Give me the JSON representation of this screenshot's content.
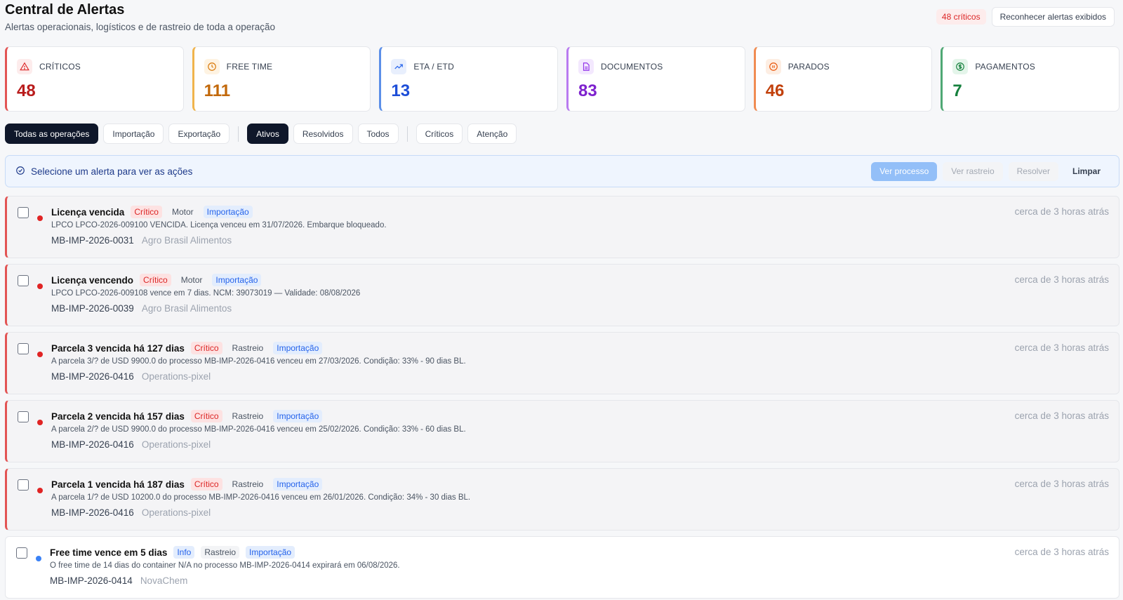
{
  "header": {
    "title": "Central de Alertas",
    "subtitle": "Alertas operacionais, logísticos e de rastreio de toda a operação",
    "critical_badge": "48 críticos",
    "ack_button": "Reconhecer alertas exibidos"
  },
  "cards": [
    {
      "label": "CRÍTICOS",
      "value": "48",
      "icon": "alert-triangle-icon",
      "color": "#dc2626",
      "border": "#e25454",
      "bg": "#fdecec"
    },
    {
      "label": "FREE TIME",
      "value": "111",
      "icon": "clock-icon",
      "color": "#d97706",
      "border": "#f0b44c",
      "bg": "#fef3e2"
    },
    {
      "label": "ETA / ETD",
      "value": "13",
      "icon": "trending-up-icon",
      "color": "#2563eb",
      "border": "#5b8fe8",
      "bg": "#e8effd"
    },
    {
      "label": "DOCUMENTOS",
      "value": "83",
      "icon": "document-icon",
      "color": "#9333ea",
      "border": "#b97bf0",
      "bg": "#f3e8fe"
    },
    {
      "label": "PARADOS",
      "value": "46",
      "icon": "pause-icon",
      "color": "#ea580c",
      "border": "#f08c52",
      "bg": "#fdeee3"
    },
    {
      "label": "PAGAMENTOS",
      "value": "7",
      "icon": "dollar-icon",
      "color": "#15803d",
      "border": "#4fa874",
      "bg": "#e4f5ea"
    }
  ],
  "filters": {
    "operation": [
      {
        "label": "Todas as operações",
        "active": true
      },
      {
        "label": "Importação",
        "active": false
      },
      {
        "label": "Exportação",
        "active": false
      }
    ],
    "status": [
      {
        "label": "Ativos",
        "active": true
      },
      {
        "label": "Resolvidos",
        "active": false
      },
      {
        "label": "Todos",
        "active": false
      }
    ],
    "severity": [
      {
        "label": "Críticos",
        "active": false
      },
      {
        "label": "Atenção",
        "active": false
      }
    ]
  },
  "action_bar": {
    "hint": "Selecione um alerta para ver as ações",
    "view_process": "Ver processo",
    "view_tracking": "Ver rastreio",
    "resolve": "Resolver",
    "clear": "Limpar"
  },
  "alerts": [
    {
      "title": "Licença vencida",
      "severity": "Crítico",
      "source": "Motor",
      "direction": "Importação",
      "description": "LPCO LPCO-2026-009100 VENCIDA. Licença venceu em 31/07/2026. Embarque bloqueado.",
      "ref": "MB-IMP-2026-0031",
      "company": "Agro Brasil Alimentos",
      "time": "cerca de 3 horas atrás",
      "level": "critical"
    },
    {
      "title": "Licença vencendo",
      "severity": "Crítico",
      "source": "Motor",
      "direction": "Importação",
      "description": "LPCO LPCO-2026-009108 vence em 7 dias. NCM: 39073019 — Validade: 08/08/2026",
      "ref": "MB-IMP-2026-0039",
      "company": "Agro Brasil Alimentos",
      "time": "cerca de 3 horas atrás",
      "level": "critical"
    },
    {
      "title": "Parcela 3 vencida há 127 dias",
      "severity": "Crítico",
      "source": "Rastreio",
      "direction": "Importação",
      "description": "A parcela 3/? de USD 9900.0 do processo MB-IMP-2026-0416 venceu em 27/03/2026. Condição: 33% - 90 dias BL.",
      "ref": "MB-IMP-2026-0416",
      "company": "Operations-pixel",
      "time": "cerca de 3 horas atrás",
      "level": "critical"
    },
    {
      "title": "Parcela 2 vencida há 157 dias",
      "severity": "Crítico",
      "source": "Rastreio",
      "direction": "Importação",
      "description": "A parcela 2/? de USD 9900.0 do processo MB-IMP-2026-0416 venceu em 25/02/2026. Condição: 33% - 60 dias BL.",
      "ref": "MB-IMP-2026-0416",
      "company": "Operations-pixel",
      "time": "cerca de 3 horas atrás",
      "level": "critical"
    },
    {
      "title": "Parcela 1 vencida há 187 dias",
      "severity": "Crítico",
      "source": "Rastreio",
      "direction": "Importação",
      "description": "A parcela 1/? de USD 10200.0 do processo MB-IMP-2026-0416 venceu em 26/01/2026. Condição: 34% - 30 dias BL.",
      "ref": "MB-IMP-2026-0416",
      "company": "Operations-pixel",
      "time": "cerca de 3 horas atrás",
      "level": "critical"
    },
    {
      "title": "Free time vence em 5 dias",
      "severity": "Info",
      "source": "Rastreio",
      "direction": "Importação",
      "description": "O free time de 14 dias do container N/A no processo MB-IMP-2026-0414 expirará em 06/08/2026.",
      "ref": "MB-IMP-2026-0414",
      "company": "NovaChem",
      "time": "cerca de 3 horas atrás",
      "level": "info"
    }
  ]
}
